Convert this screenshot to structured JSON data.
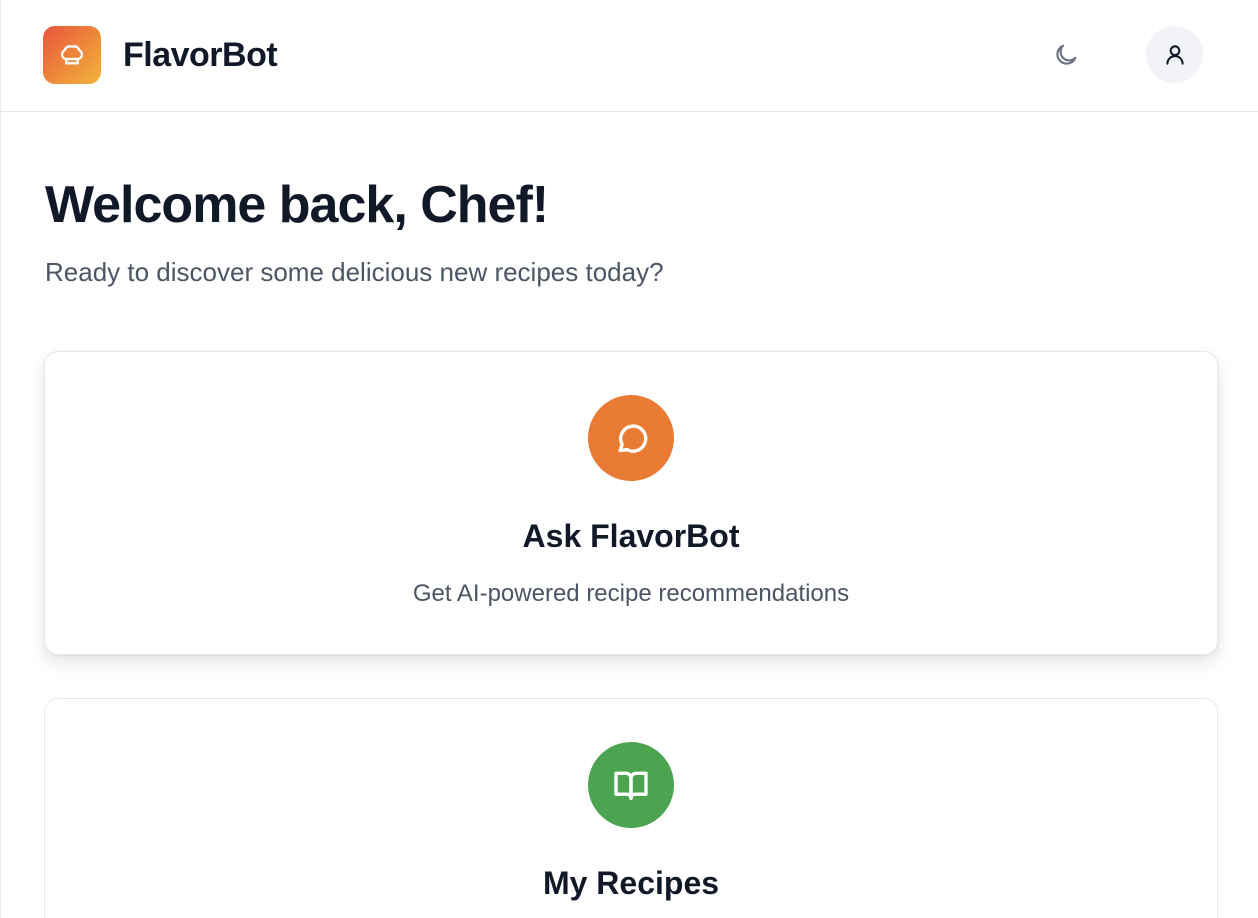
{
  "header": {
    "brand_name": "FlavorBot",
    "logo_icon": "chef-hat-icon",
    "theme_toggle_icon": "moon-icon",
    "profile_icon": "user-icon"
  },
  "welcome": {
    "title": "Welcome back, Chef!",
    "subtitle": "Ready to discover some delicious new recipes today?"
  },
  "cards": [
    {
      "title": "Ask FlavorBot",
      "description": "Get AI-powered recipe recommendations",
      "icon": "chat-bubble-icon",
      "icon_color": "#E97B35"
    },
    {
      "title": "My Recipes",
      "icon": "open-book-icon",
      "icon_color": "#4CA450"
    }
  ],
  "colors": {
    "brand_gradient": [
      "#E8553F",
      "#F2B33D"
    ],
    "text_primary": "#111827",
    "text_secondary": "#4B5563"
  }
}
